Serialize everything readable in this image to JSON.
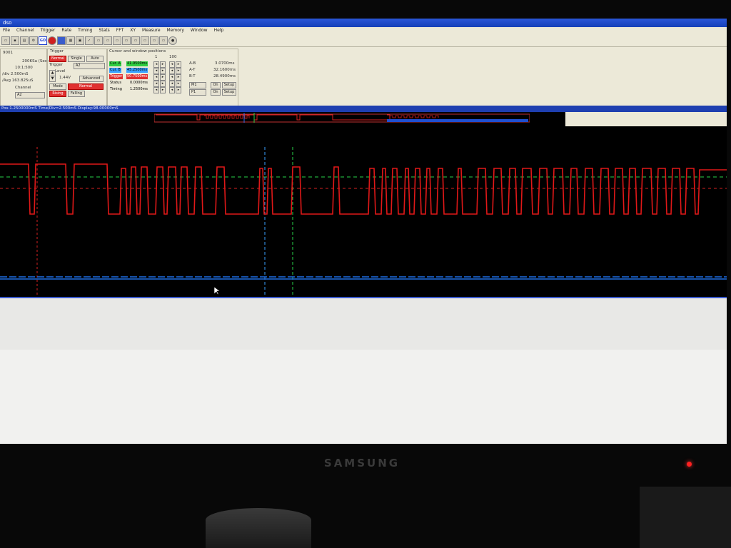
{
  "window": {
    "title": "dso"
  },
  "menu": [
    "File",
    "Channel",
    "Trigger",
    "Rate",
    "Timing",
    "Stats",
    "FFT",
    "XY",
    "Measure",
    "Memory",
    "Window",
    "Help"
  ],
  "toolbar": {
    "go_label": "GO"
  },
  "settings": {
    "device": "9001",
    "samplerate": "200KSa (Sec)",
    "ratio": "10:1:500",
    "div": "/div 2.500mS",
    "avg": "/Avg 163.825uS",
    "channel_label": "Channel",
    "channel_value": "A2"
  },
  "trigger": {
    "title": "Trigger",
    "normal_label": "Normal",
    "single_label": "Single",
    "auto_label": "Auto",
    "source_label": "Trigger",
    "source_value": "A2",
    "level_label": "Level",
    "level_value": "1.44V",
    "advanced_label": "Advanced",
    "mode_label": "Mode",
    "mode_value": "Normal",
    "rising_label": "Rising",
    "falling_label": "Falling"
  },
  "cursors": {
    "title": "Cursor and window positions",
    "col1": "1",
    "col2": "100",
    "rows": [
      {
        "name": "Cur. A",
        "value": "41.9500ms",
        "color": "#2ecc40"
      },
      {
        "name": "Cur. B",
        "value": "45.2500ms",
        "color": "#3aa0ff"
      },
      {
        "name": "Trigger",
        "value": "50.7500ms",
        "color": "#e03030"
      },
      {
        "name": "Status",
        "value": "0.0000ms",
        "color": ""
      },
      {
        "name": "Timing",
        "value": "1.2500ms",
        "color": ""
      }
    ],
    "deltas": [
      {
        "name": "A-B",
        "value": "3.0700ms"
      },
      {
        "name": "A-T",
        "value": "32.1600ms"
      },
      {
        "name": "B-T",
        "value": "28.4900ms"
      }
    ],
    "m_select": "M1",
    "p_select": "P1",
    "on_label": "On",
    "setup_label": "Setup"
  },
  "status_line": "Pos:1.2500000mS Time/Div=2.500mS Display:98.00000mS",
  "colors": {
    "channel_a": "#e01818",
    "channel_b": "#1f6fe6",
    "cursor_a": "#29d44a",
    "cursor_b": "#3aa0ff",
    "trigger_marker": "#d42020",
    "accent": "#1e3fb0"
  },
  "bezel": {
    "brand": "SAMSUNG"
  }
}
